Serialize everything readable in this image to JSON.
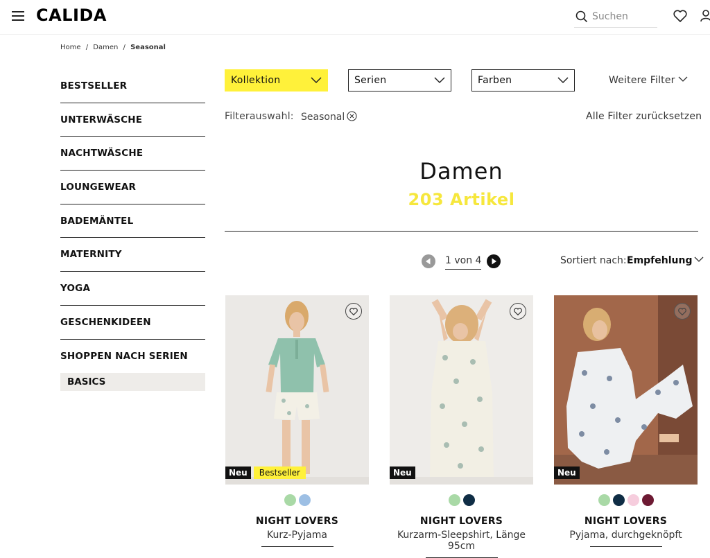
{
  "header": {
    "logo": "CALIDA",
    "search_placeholder": "Suchen"
  },
  "breadcrumb": [
    "Home",
    "/",
    "Damen",
    "/",
    "Seasonal"
  ],
  "sidebar": {
    "items": [
      {
        "label": "BESTSELLER"
      },
      {
        "label": "UNTERWÄSCHE"
      },
      {
        "label": "NACHTWÄSCHE"
      },
      {
        "label": "LOUNGEWEAR"
      },
      {
        "label": "BADEMÄNTEL"
      },
      {
        "label": "MATERNITY"
      },
      {
        "label": "YOGA"
      },
      {
        "label": "GESCHENKIDEEN"
      },
      {
        "label": "SHOPPEN NACH SERIEN"
      }
    ],
    "sub_item": "BASICS"
  },
  "filters": {
    "dropdowns": [
      "Kollektion",
      "Serien",
      "Farben"
    ],
    "more": "Weitere Filter",
    "selection_label": "Filterauswahl:",
    "selected_chip": "Seasonal",
    "reset": "Alle Filter zurücksetzen",
    "active_color": "#fff13a"
  },
  "listing": {
    "title": "Damen",
    "count": "203 Artikel"
  },
  "pagination": {
    "text": "1 von 4"
  },
  "sort": {
    "label": "Sortiert nach:",
    "value": "Empfehlung"
  },
  "products": [
    {
      "series": "NIGHT LOVERS",
      "name": "Kurz-Pyjama",
      "badges": [
        "Neu",
        "Bestseller"
      ],
      "swatches": [
        "#a9d9a6",
        "#9dbfe4"
      ]
    },
    {
      "series": "NIGHT LOVERS",
      "name": "Kurzarm-Sleepshirt, Länge 95cm",
      "badges": [
        "Neu"
      ],
      "swatches": [
        "#a9d9a6",
        "#0f2d45"
      ]
    },
    {
      "series": "NIGHT LOVERS",
      "name": "Pyjama, durchgeknöpft",
      "badges": [
        "Neu"
      ],
      "swatches": [
        "#a9d9a6",
        "#0f2d45",
        "#f6cddd",
        "#6d1a33"
      ]
    }
  ]
}
